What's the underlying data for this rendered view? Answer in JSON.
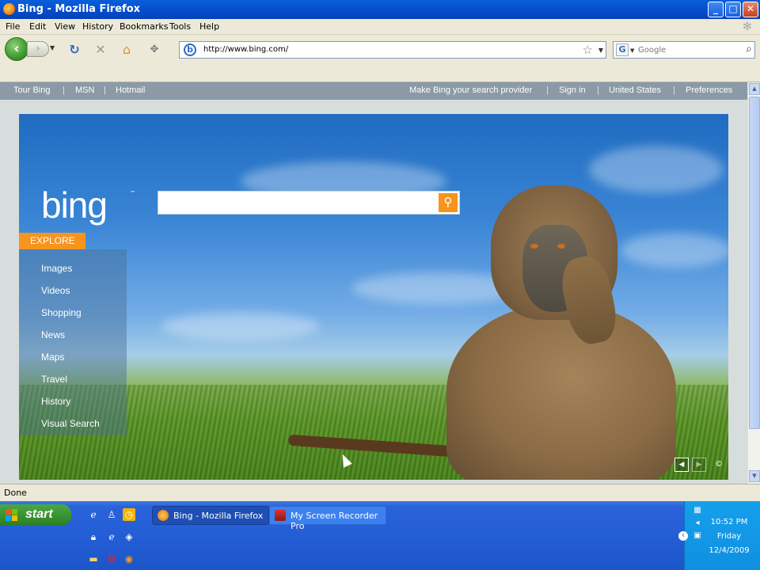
{
  "window": {
    "title": "Bing - Mozilla Firefox",
    "min": "_",
    "max": "□",
    "close": "✕"
  },
  "menu": [
    "File",
    "Edit",
    "View",
    "History",
    "Bookmarks",
    "Tools",
    "Help"
  ],
  "toolbar": {
    "url": "http://www.bing.com/",
    "search_placeholder": "Google",
    "icons": [
      "back-icon",
      "forward-icon",
      "reload-icon",
      "stop-icon",
      "home-icon",
      "addon-icon"
    ]
  },
  "bing": {
    "topnav_left": [
      "Tour Bing",
      "MSN",
      "Hotmail"
    ],
    "topnav_right": [
      "Make Bing your search provider",
      "Sign in",
      "United States",
      "Preferences"
    ],
    "separator": "|",
    "logo": "bing",
    "explore_label": "EXPLORE",
    "explore_items": [
      "Images",
      "Videos",
      "Shopping",
      "News",
      "Maps",
      "Travel",
      "History",
      "Visual Search"
    ],
    "copyright": "©",
    "accent_color": "#f7941d"
  },
  "status": {
    "text": "Done"
  },
  "taskbar": {
    "start": "start",
    "tasks": [
      "Bing - Mozilla Firefox",
      "My Screen Recorder Pro"
    ],
    "clock": {
      "time": "10:52 PM",
      "day": "Friday",
      "date": "12/4/2009"
    }
  }
}
